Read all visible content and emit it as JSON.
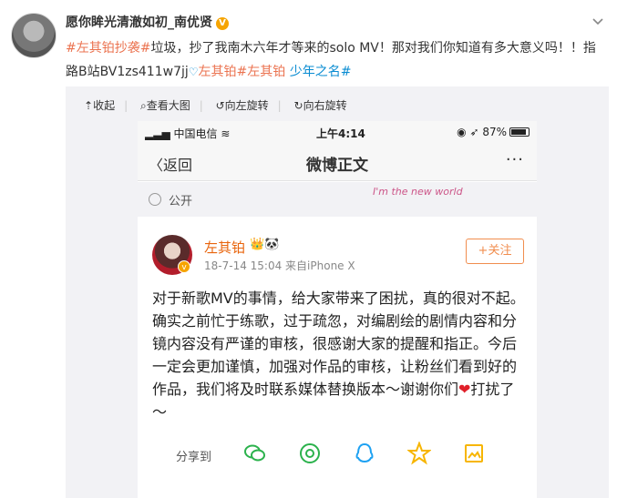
{
  "post": {
    "username": "愿你眸光清澈如初_南优贤",
    "text_line1_tag": "#左其铂抄袭#",
    "text_line1_rest": "垃圾，抄了我南木六年才等来的solo MV！那对我们你知道有多大意义吗！！指",
    "text_line2_start": "路B站BV1zs411w7jj",
    "text_line2_tag1": "左其铂",
    "text_line2_tag2": "#左其铂",
    "text_line2_tag3": "少年之名#"
  },
  "media_toolbar": {
    "collapse": "收起",
    "view_large": "查看大图",
    "rotate_left": "向左旋转",
    "rotate_right": "向右旋转"
  },
  "phone": {
    "carrier": "中国电信",
    "time": "上午4:14",
    "battery": "87%",
    "back_label": "返回",
    "title": "微博正文",
    "public_label": "公开",
    "watermark": "I'm the new world",
    "author_name": "左其铂",
    "meta": "18-7-14 15:04  来自iPhone X",
    "follow_label": "+关注",
    "body_part1": "对于新歌MV的事情，给大家带来了困扰，真的很对不起。确实之前忙于练歌，过于疏忽，对编剧绘的剧情内容和分镜内容没有严谨的审核，很感谢大家的提醒和指正。今后一定会更加谨慎，加强对作品的审核，让粉丝们看到好的作品，我们将及时联系媒体替换版本～谢谢你们",
    "body_part2": "打扰了～",
    "share_label": "分享到"
  },
  "colors": {
    "tag_orange": "#eb7350",
    "link_blue": "#0a8cd2",
    "share_green": "#2bb24c",
    "share_blue": "#1da1f2",
    "share_yellow": "#f7b500"
  }
}
